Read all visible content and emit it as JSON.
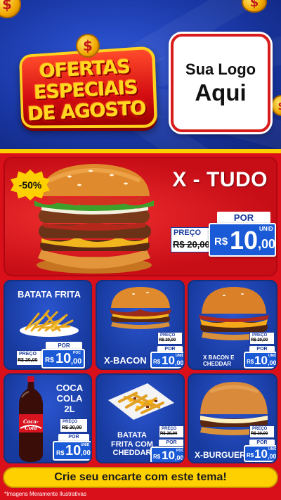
{
  "header": {
    "title_lines": [
      "Ofertas",
      "Especiais",
      "de Agosto"
    ],
    "coin_symbol": "$",
    "logo_line1": "Sua Logo",
    "logo_line2": "Aqui"
  },
  "hero": {
    "name": "X - TUDO",
    "discount": "-50%",
    "por": "POR",
    "preco_label": "PREÇO",
    "old_price": "R$ 20,00",
    "currency": "R$",
    "price_int": "10",
    "price_cents": ",00",
    "unit": "UNID"
  },
  "products": [
    {
      "name": "BATATA FRITA",
      "preco_label": "PREÇO",
      "old_price": "R$ 20,00",
      "por": "POR",
      "currency": "R$",
      "price_int": "10",
      "price_cents": ",00",
      "unit": "POC"
    },
    {
      "name": "X-BACON",
      "preco_label": "PREÇO",
      "old_price": "R$ 20,00",
      "por": "POR",
      "currency": "R$",
      "price_int": "10",
      "price_cents": ",00",
      "unit": "UNID"
    },
    {
      "name_lines": [
        "X BACON E",
        "CHEDDAR"
      ],
      "preco_label": "PREÇO",
      "old_price": "R$ 20,00",
      "por": "POR",
      "currency": "R$",
      "price_int": "10",
      "price_cents": ",00",
      "unit": "UNID"
    },
    {
      "name_lines": [
        "COCA",
        "COLA",
        "2L"
      ],
      "preco_label": "PREÇO",
      "old_price": "R$ 20,00",
      "por": "POR",
      "currency": "R$",
      "price_int": "10",
      "price_cents": ",00",
      "unit": "UNID",
      "bottle_label": "Coca-Cola"
    },
    {
      "name_lines": [
        "BATATA",
        "FRITA COM",
        "CHEDDAR"
      ],
      "preco_label": "PREÇO",
      "old_price": "R$ 20,00",
      "por": "POR",
      "currency": "R$",
      "price_int": "10",
      "price_cents": ",00",
      "unit": "POC"
    },
    {
      "name": "X-BURGUER",
      "preco_label": "PREÇO",
      "old_price": "R$ 20,00",
      "por": "POR",
      "currency": "R$",
      "price_int": "10",
      "price_cents": ",00",
      "unit": "UNID"
    }
  ],
  "footer": {
    "cta": "Crie seu encarte com este tema!",
    "disclaimer": "*Imagens Meramente Ilustrativas"
  },
  "colors": {
    "primary_blue": "#1b3a9c",
    "primary_red": "#d9101a",
    "accent_yellow": "#ffd000",
    "price_blue": "#1b5ad6"
  }
}
